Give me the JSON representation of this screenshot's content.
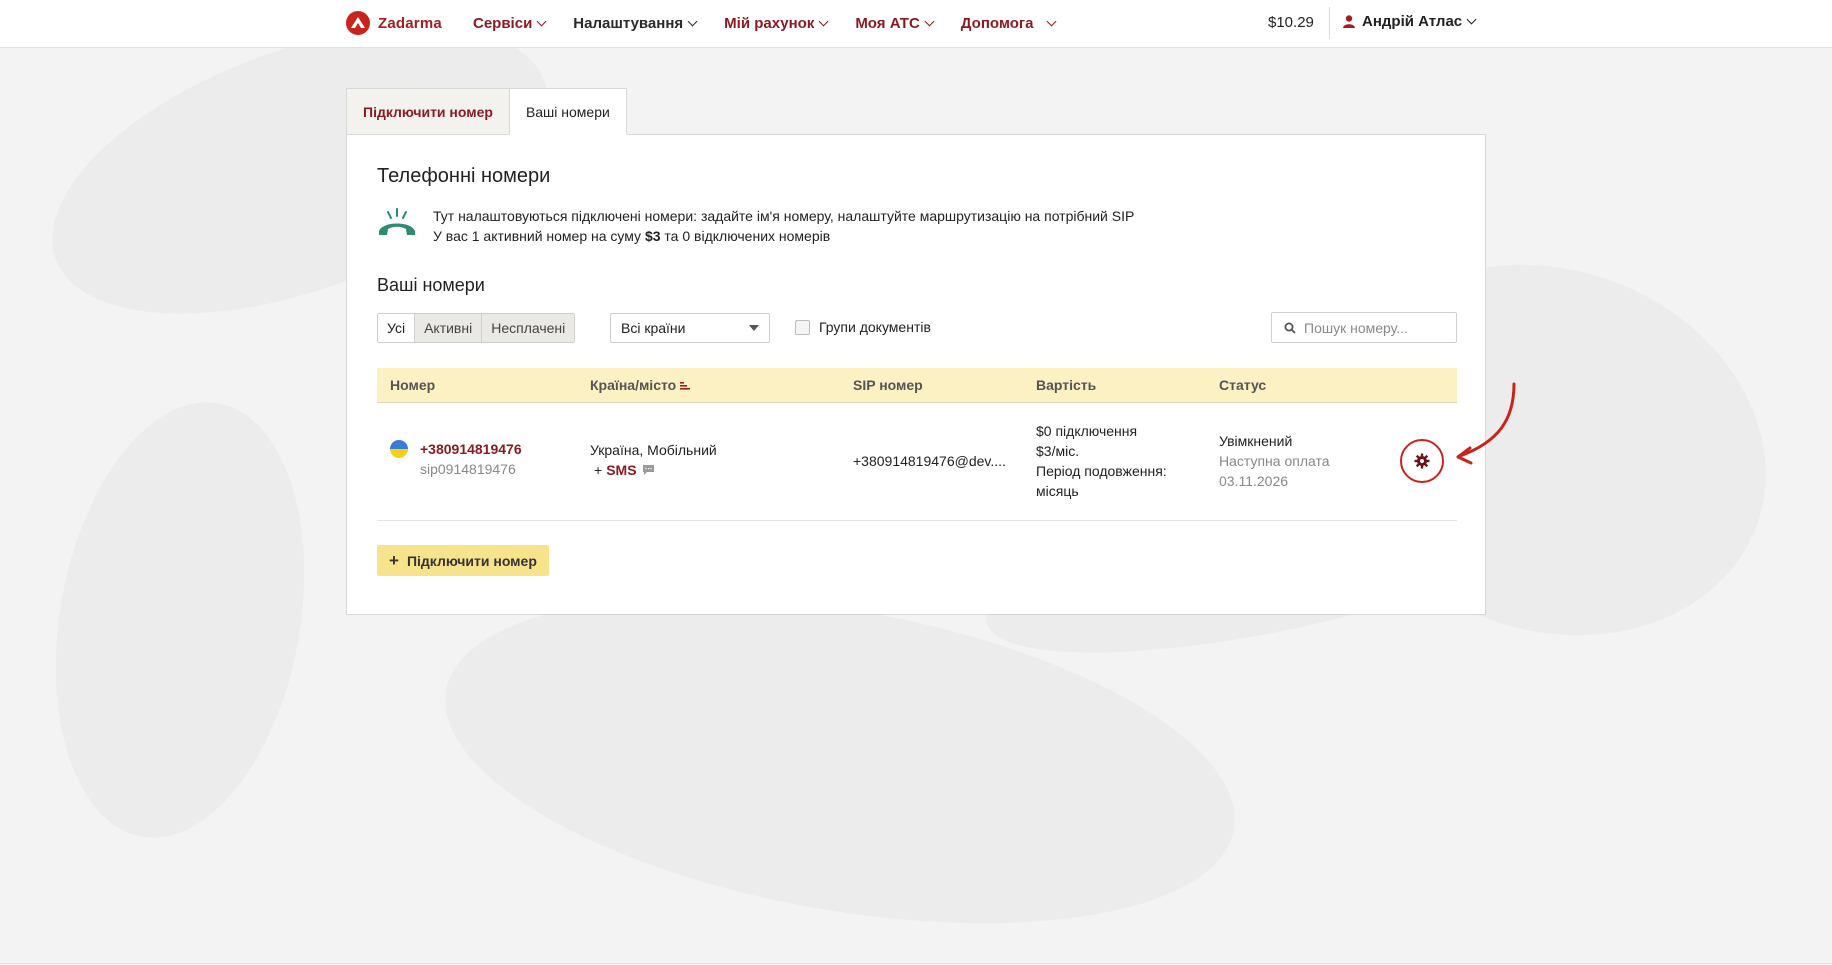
{
  "brand": {
    "name": "Zadarma",
    "accent": "#a51d24"
  },
  "nav": {
    "items": [
      {
        "label": "Сервіси"
      },
      {
        "label": "Налаштування"
      },
      {
        "label": "Мій рахунок"
      },
      {
        "label": "Моя АТС"
      },
      {
        "label": "Допомога"
      }
    ]
  },
  "account": {
    "balance": "$10.29",
    "user_name": "Андрій Атлас"
  },
  "tabs": [
    {
      "label": "Підключити номер",
      "active": false
    },
    {
      "label": "Ваші номери",
      "active": true
    }
  ],
  "panel": {
    "title": "Телефонні номери",
    "description_line1": "Тут налаштовуються підключені номери: задайте ім'я номеру, налаштуйте маршрутизацію на потрібний SIP",
    "description_line2_prefix": "У вас 1 активний номер на суму ",
    "description_line2_amount": "$3",
    "description_line2_suffix": " та 0 відключених номерів",
    "section_title": "Ваші номери"
  },
  "filters": {
    "segments": [
      {
        "label": "Усі",
        "selected": true
      },
      {
        "label": "Активні",
        "selected": false
      },
      {
        "label": "Несплачені",
        "selected": false
      }
    ],
    "country_select": "Всі країни",
    "group_docs_label": "Групи документів",
    "group_docs_checked": false,
    "search_placeholder": "Пошук номеру..."
  },
  "table": {
    "columns": [
      "Номер",
      "Країна/місто",
      "SIP номер",
      "Вартість",
      "Статус"
    ],
    "rows": [
      {
        "number": "+380914819476",
        "sip_login": "sip0914819476",
        "country_city": "Україна, Мобільний",
        "sms_prefix": "+",
        "sms_label": "SMS",
        "sip_number": "+380914819476@dev....",
        "cost_line1": "$0 підключення",
        "cost_line2": "$3/міс.",
        "cost_line3": "Період подовження:",
        "cost_line4": "місяць",
        "status": "Увімкнений",
        "next_payment_label": "Наступна оплата",
        "next_payment_date": "03.11.2026"
      }
    ]
  },
  "actions": {
    "add_number_label": "Підключити номер"
  },
  "icons": {
    "logo": "zadarma-logo-icon",
    "user": "user-icon",
    "phone": "phone-ringing-icon",
    "search": "search-icon",
    "sort": "sort-icon",
    "flag": "ukraine-flag-icon",
    "sms": "chat-icon",
    "gear": "gear-icon",
    "plus": "plus-icon",
    "annotation": "arrow-annotation-icon"
  },
  "colors": {
    "link": "#8a1a1f",
    "table_header_bg": "#fbf1c2",
    "add_button_bg": "#f7e38c",
    "highlight": "#c8241d"
  }
}
